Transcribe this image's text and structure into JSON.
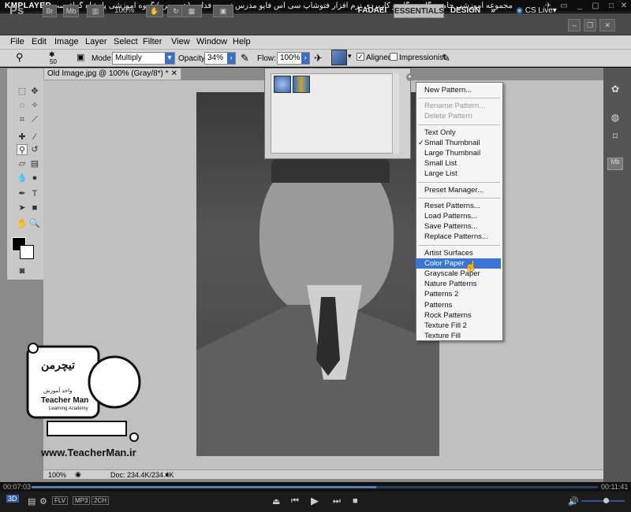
{
  "km": {
    "brand": "KMPLAYER",
    "title": "مجموعه آموزشی جامع ، گام به گام و کاربردی نرم افزار فتوشاپ سی اس فایو  مدرس :سعید فدایی ( تیچرمن ) گروه آموزشی پادشاه گرافیست ها",
    "time_elapsed": "00:07:03",
    "time_total": "00:11:41",
    "badges": [
      "FLV",
      "MP3",
      "2CH"
    ],
    "btn_3d": "3D"
  },
  "ps": {
    "logo": "Ps",
    "icons": [
      "Br",
      "Mb"
    ],
    "zoom": "100%",
    "workspaces": [
      "FADAEI",
      "ESSENTIALS",
      "DESIGN"
    ],
    "cs_live": "CS Live"
  },
  "menu": [
    "File",
    "Edit",
    "Image",
    "Layer",
    "Select",
    "Filter",
    "View",
    "Window",
    "Help"
  ],
  "options": {
    "brush_size": "50",
    "mode_label": "Mode:",
    "mode_value": "Multiply",
    "opacity_label": "Opacity:",
    "opacity_value": "34%",
    "flow_label": "Flow:",
    "flow_value": "100%",
    "aligned_label": "Aligned",
    "impressionist_label": "Impressionist"
  },
  "doc": {
    "tab": "Old Image.jpg @ 100% (Gray/8*) *",
    "status_zoom": "100%",
    "status_doc": "Doc: 234.4K/234.4K"
  },
  "context_menu": [
    {
      "label": "New Pattern...",
      "state": "normal"
    },
    {
      "sep": true
    },
    {
      "label": "Rename Pattern...",
      "state": "disabled"
    },
    {
      "label": "Delete Pattern",
      "state": "disabled"
    },
    {
      "sep": true
    },
    {
      "label": "Text Only",
      "state": "normal"
    },
    {
      "label": "Small Thumbnail",
      "state": "checked"
    },
    {
      "label": "Large Thumbnail",
      "state": "normal"
    },
    {
      "label": "Small List",
      "state": "normal"
    },
    {
      "label": "Large List",
      "state": "normal"
    },
    {
      "sep": true
    },
    {
      "label": "Preset Manager...",
      "state": "normal"
    },
    {
      "sep": true
    },
    {
      "label": "Reset Patterns...",
      "state": "normal"
    },
    {
      "label": "Load Patterns...",
      "state": "normal"
    },
    {
      "label": "Save Patterns...",
      "state": "normal"
    },
    {
      "label": "Replace Patterns...",
      "state": "normal"
    },
    {
      "sep": true
    },
    {
      "label": "Artist Surfaces",
      "state": "normal"
    },
    {
      "label": "Color Paper",
      "state": "highlighted"
    },
    {
      "label": "Grayscale Paper",
      "state": "normal"
    },
    {
      "label": "Nature Patterns",
      "state": "normal"
    },
    {
      "label": "Patterns 2",
      "state": "normal"
    },
    {
      "label": "Patterns",
      "state": "normal"
    },
    {
      "label": "Rock Patterns",
      "state": "normal"
    },
    {
      "label": "Texture Fill 2",
      "state": "normal"
    },
    {
      "label": "Texture Fill",
      "state": "normal"
    }
  ],
  "logo": {
    "name_fa": "تیچرمن",
    "tagline_fa": "واحد آموزش",
    "name_en": "Teacher Man",
    "sub": "Learning Academy",
    "url": "www.TeacherMan.ir"
  },
  "colors": {
    "accent": "#3875d7",
    "ps_chrome": "#4a4a4a",
    "km_bg": "#0d0d0d"
  }
}
